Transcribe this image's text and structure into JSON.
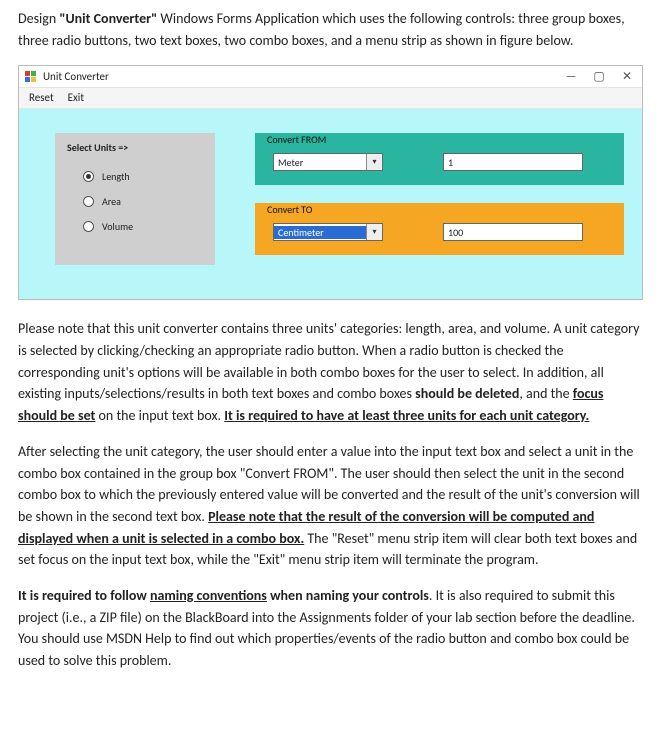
{
  "intro": {
    "prefix": "Design ",
    "appname": "\"Unit Converter\"",
    "rest": " Windows Forms Application which uses the following controls: three group boxes, three radio buttons, two text boxes, two combo boxes, and a menu strip as shown in figure below."
  },
  "window": {
    "title": "Unit Converter",
    "menu": {
      "reset": "Reset",
      "exit": "Exit"
    },
    "select": {
      "legend": "Select Units =>",
      "opt_length": "Length",
      "opt_area": "Area",
      "opt_volume": "Volume"
    },
    "from": {
      "legend": "Convert FROM",
      "combo": "Meter",
      "value": "1"
    },
    "to": {
      "legend": "Convert TO",
      "combo": "Centimeter",
      "value": "100"
    }
  },
  "para2": {
    "a": "Please note that this unit converter contains three units' categories: length, area, and volume. A unit category is selected by clicking/checking an appropriate radio button.  When a radio button is checked the corresponding unit's options will be available in both combo boxes for the user to select.  In addition, all existing inputs/selections/results in both text boxes and combo boxes ",
    "b": "should be deleted",
    "c": ", and the ",
    "d": "focus should be set",
    "e": " on the input text box. ",
    "f": "It is required to have at least three units for each unit category."
  },
  "para3": {
    "a": "After selecting the unit category, the user should enter a value into the input text box and select a unit in the combo box contained in the group box \"Convert FROM\". The user should then select the unit in the second combo box to which the previously entered value will be converted and the result of the unit's conversion will be shown in the second text box. ",
    "b": "Please note that the result of the conversion will be computed and displayed when a unit is selected in a combo box.",
    "c": " The \"Reset\" menu strip item will clear both text boxes and set focus on the input text box, while the \"Exit\" menu strip item will terminate the program."
  },
  "para4": {
    "a": "It is required to follow ",
    "b": "naming conventions",
    "c": " when naming your controls",
    "d": ". It is also required to submit this project (i.e., a ZIP file) on the BlackBoard into the Assignments folder of your lab section before the deadline. You should use MSDN Help to find out which properties/events of the radio button and combo box could be used to solve this problem."
  }
}
